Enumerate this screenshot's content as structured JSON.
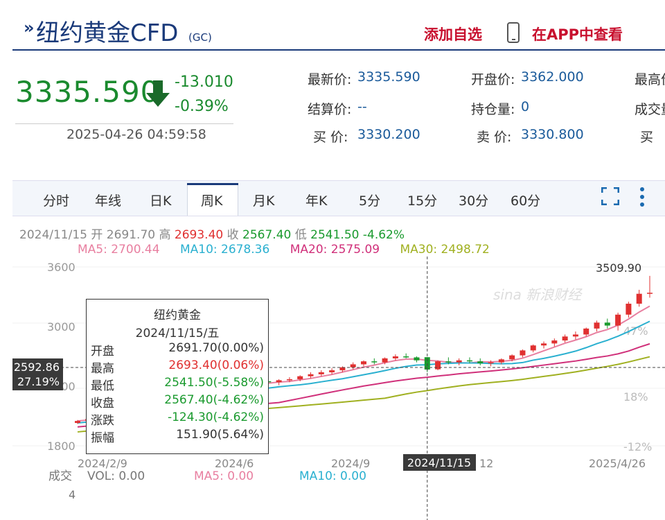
{
  "header": {
    "icon": "»",
    "title": "纽约黄金CFD",
    "code": "(GC)",
    "add_favorite": "添加自选",
    "view_in_app": "在APP中查看"
  },
  "quote": {
    "price": "3335.590",
    "change": "-13.010",
    "change_pct": "-0.39%",
    "timestamp": "2025-04-26 04:59:58",
    "fields": [
      {
        "label": "最新价:",
        "value": "3335.590"
      },
      {
        "label": "结算价:",
        "value": "--"
      },
      {
        "label": "买  价:",
        "value": "3330.200"
      },
      {
        "label": "开盘价:",
        "value": "3362.000"
      },
      {
        "label": "持仓量:",
        "value": "0"
      },
      {
        "label": "卖  价:",
        "value": "3330.800"
      },
      {
        "label": "最高价",
        "value": ""
      },
      {
        "label": "成交量",
        "value": ""
      },
      {
        "label": "买  ",
        "value": ""
      }
    ]
  },
  "tabs": [
    "分时",
    "年线",
    "日K",
    "周K",
    "月K",
    "年K",
    "5分",
    "15分",
    "30分",
    "60分"
  ],
  "active_tab": "周K",
  "ohlc_bar": {
    "date": "2024/11/15",
    "open_label": "开",
    "open": "2691.70",
    "high_label": "高",
    "high": "2693.40",
    "close_label": "收",
    "close": "2567.40",
    "low_label": "低",
    "low": "2541.50",
    "pct": "-4.62%"
  },
  "ma_bar": {
    "ma5": "MA5: 2700.44",
    "ma10": "MA10: 2678.36",
    "ma20": "MA20: 2575.09",
    "ma30": "MA30: 2498.72"
  },
  "colors": {
    "up": "#e03030",
    "down": "#1a9a2e",
    "ma5": "#e87fa0",
    "ma10": "#2ab0d0",
    "ma20": "#d0307a",
    "ma30": "#a0b020",
    "brand": "#1a3a7a"
  },
  "tooltip": {
    "title": "纽约黄金",
    "date": "2024/11/15/五",
    "rows": [
      {
        "k": "开盘",
        "v": "2691.70(0.00%)",
        "c": "#333"
      },
      {
        "k": "最高",
        "v": "2693.40(0.06%)",
        "c": "#e03030"
      },
      {
        "k": "最低",
        "v": "2541.50(-5.58%)",
        "c": "#1a9a2e"
      },
      {
        "k": "收盘",
        "v": "2567.40(-4.62%)",
        "c": "#1a9a2e"
      },
      {
        "k": "涨跌",
        "v": "-124.30(-4.62%)",
        "c": "#1a9a2e"
      },
      {
        "k": "振幅",
        "v": "151.90(5.64%)",
        "c": "#333"
      }
    ]
  },
  "chart_data": {
    "type": "candlestick",
    "y_ticks": [
      "3600",
      "3000",
      "2400",
      "1800"
    ],
    "ylim": [
      1800,
      3600
    ],
    "right_ticks": [
      "47%",
      "18%",
      "-12%"
    ],
    "x_ticks": [
      "2024/2/9",
      "2024/6",
      "2024/9",
      "12",
      "2025/4/26"
    ],
    "crosshair_x_label": "2024/11/15",
    "crosshair_y_label": "2592.86",
    "crosshair_y_pct": "27.19%",
    "max_label": "3509.90",
    "watermark": "sina 新浪财经",
    "candles": [
      {
        "o": 2030,
        "h": 2060,
        "l": 2020,
        "c": 2050
      },
      {
        "o": 2050,
        "h": 2080,
        "l": 2040,
        "c": 2070
      },
      {
        "o": 2070,
        "h": 2100,
        "l": 2055,
        "c": 2090
      },
      {
        "o": 2090,
        "h": 2120,
        "l": 2080,
        "c": 2110
      },
      {
        "o": 2110,
        "h": 2150,
        "l": 2100,
        "c": 2140
      },
      {
        "o": 2140,
        "h": 2190,
        "l": 2130,
        "c": 2180
      },
      {
        "o": 2180,
        "h": 2230,
        "l": 2170,
        "c": 2220
      },
      {
        "o": 2220,
        "h": 2260,
        "l": 2200,
        "c": 2250
      },
      {
        "o": 2250,
        "h": 2330,
        "l": 2240,
        "c": 2320
      },
      {
        "o": 2320,
        "h": 2360,
        "l": 2290,
        "c": 2330
      },
      {
        "o": 2330,
        "h": 2380,
        "l": 2310,
        "c": 2370
      },
      {
        "o": 2370,
        "h": 2420,
        "l": 2350,
        "c": 2400
      },
      {
        "o": 2400,
        "h": 2430,
        "l": 2370,
        "c": 2390
      },
      {
        "o": 2390,
        "h": 2420,
        "l": 2350,
        "c": 2370
      },
      {
        "o": 2370,
        "h": 2410,
        "l": 2340,
        "c": 2400
      },
      {
        "o": 2400,
        "h": 2450,
        "l": 2380,
        "c": 2440
      },
      {
        "o": 2440,
        "h": 2470,
        "l": 2410,
        "c": 2420
      },
      {
        "o": 2420,
        "h": 2460,
        "l": 2400,
        "c": 2450
      },
      {
        "o": 2450,
        "h": 2480,
        "l": 2430,
        "c": 2440
      },
      {
        "o": 2440,
        "h": 2470,
        "l": 2410,
        "c": 2460
      },
      {
        "o": 2460,
        "h": 2490,
        "l": 2440,
        "c": 2470
      },
      {
        "o": 2470,
        "h": 2510,
        "l": 2450,
        "c": 2500
      },
      {
        "o": 2500,
        "h": 2540,
        "l": 2480,
        "c": 2520
      },
      {
        "o": 2520,
        "h": 2560,
        "l": 2500,
        "c": 2540
      },
      {
        "o": 2540,
        "h": 2580,
        "l": 2520,
        "c": 2560
      },
      {
        "o": 2560,
        "h": 2600,
        "l": 2540,
        "c": 2590
      },
      {
        "o": 2590,
        "h": 2640,
        "l": 2570,
        "c": 2620
      },
      {
        "o": 2620,
        "h": 2660,
        "l": 2600,
        "c": 2650
      },
      {
        "o": 2650,
        "h": 2680,
        "l": 2620,
        "c": 2640
      },
      {
        "o": 2640,
        "h": 2690,
        "l": 2620,
        "c": 2680
      },
      {
        "o": 2680,
        "h": 2720,
        "l": 2660,
        "c": 2700
      },
      {
        "o": 2700,
        "h": 2730,
        "l": 2680,
        "c": 2690
      },
      {
        "o": 2690,
        "h": 2700,
        "l": 2640,
        "c": 2660
      },
      {
        "o": 2691.7,
        "h": 2693.4,
        "l": 2541.5,
        "c": 2567.4
      },
      {
        "o": 2570,
        "h": 2660,
        "l": 2560,
        "c": 2650
      },
      {
        "o": 2650,
        "h": 2690,
        "l": 2620,
        "c": 2640
      },
      {
        "o": 2640,
        "h": 2680,
        "l": 2610,
        "c": 2660
      },
      {
        "o": 2660,
        "h": 2690,
        "l": 2630,
        "c": 2650
      },
      {
        "o": 2650,
        "h": 2680,
        "l": 2610,
        "c": 2630
      },
      {
        "o": 2630,
        "h": 2660,
        "l": 2600,
        "c": 2640
      },
      {
        "o": 2640,
        "h": 2680,
        "l": 2620,
        "c": 2670
      },
      {
        "o": 2670,
        "h": 2720,
        "l": 2650,
        "c": 2710
      },
      {
        "o": 2710,
        "h": 2770,
        "l": 2690,
        "c": 2760
      },
      {
        "o": 2760,
        "h": 2820,
        "l": 2740,
        "c": 2810
      },
      {
        "o": 2810,
        "h": 2850,
        "l": 2780,
        "c": 2830
      },
      {
        "o": 2830,
        "h": 2880,
        "l": 2800,
        "c": 2860
      },
      {
        "o": 2860,
        "h": 2920,
        "l": 2840,
        "c": 2900
      },
      {
        "o": 2900,
        "h": 2950,
        "l": 2870,
        "c": 2920
      },
      {
        "o": 2920,
        "h": 2990,
        "l": 2900,
        "c": 2980
      },
      {
        "o": 2980,
        "h": 3060,
        "l": 2950,
        "c": 3040
      },
      {
        "o": 3040,
        "h": 3080,
        "l": 2980,
        "c": 3010
      },
      {
        "o": 3010,
        "h": 3140,
        "l": 2960,
        "c": 3120
      },
      {
        "o": 3120,
        "h": 3250,
        "l": 3090,
        "c": 3230
      },
      {
        "o": 3230,
        "h": 3370,
        "l": 3200,
        "c": 3330
      },
      {
        "o": 3330,
        "h": 3509.9,
        "l": 3290,
        "c": 3340
      }
    ]
  },
  "volume_bar": {
    "label": "成交",
    "vol": "VOL: 0.00",
    "ma5": "MA5: 0.00",
    "ma10": "MA10: 0.00",
    "axis_value": "4"
  }
}
